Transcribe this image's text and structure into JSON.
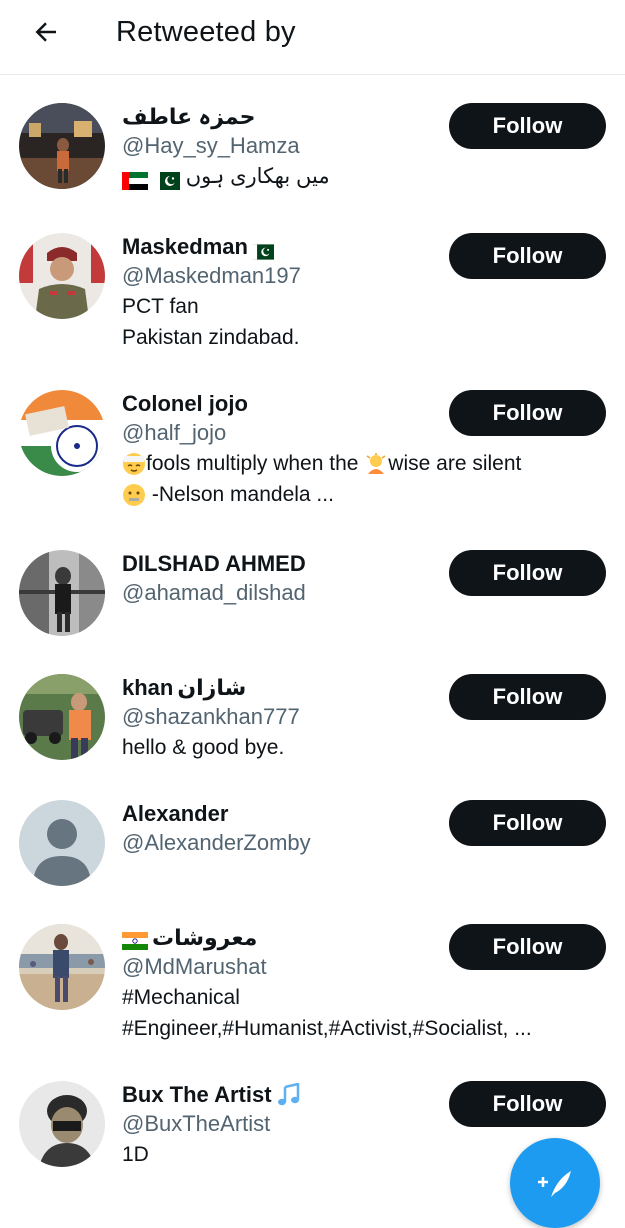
{
  "header": {
    "title": "Retweeted by",
    "back_icon": "arrow-left-icon"
  },
  "follow_label": "Follow",
  "users": [
    {
      "name": "حمزہ عاطف",
      "handle": "@Hay_sy_Hamza",
      "bio": [
        "میں بھکاری ہوں"
      ],
      "bio_flags": [
        "flag-uae-icon",
        "flag-pakistan-icon"
      ]
    },
    {
      "name": "Maskedman",
      "name_flag": "flag-pakistan-icon",
      "handle": "@Maskedman197",
      "bio": [
        "PCT fan",
        "Pakistan zindabad."
      ]
    },
    {
      "name": "Colonel jojo",
      "handle": "@half_jojo",
      "bio": [
        "fools multiply when the",
        "wise are silent",
        "-Nelson mandela ..."
      ]
    },
    {
      "name": "DILSHAD AHMED",
      "handle": "@ahamad_dilshad",
      "bio": []
    },
    {
      "name": "khan",
      "name_rtl": "شازان",
      "handle": "@shazankhan777",
      "bio": [
        "hello & good bye."
      ]
    },
    {
      "name": "Alexander",
      "handle": "@AlexanderZomby",
      "bio": []
    },
    {
      "name": "معروشات",
      "name_flag": "flag-india-icon",
      "handle": "@MdMarushat",
      "bio": [
        "#Mechanical",
        "#Engineer,#Humanist,#Activist,#Socialist, ..."
      ]
    },
    {
      "name": "Bux The Artist",
      "name_icon": "music-note-icon",
      "handle": "@BuxTheArtist",
      "bio": [
        "1D"
      ]
    }
  ],
  "fab": {
    "icon": "compose-tweet-icon"
  },
  "colors": {
    "accent": "#1d9bf0",
    "text": "#0f1419",
    "secondary": "#536471",
    "button": "#0f1419"
  }
}
